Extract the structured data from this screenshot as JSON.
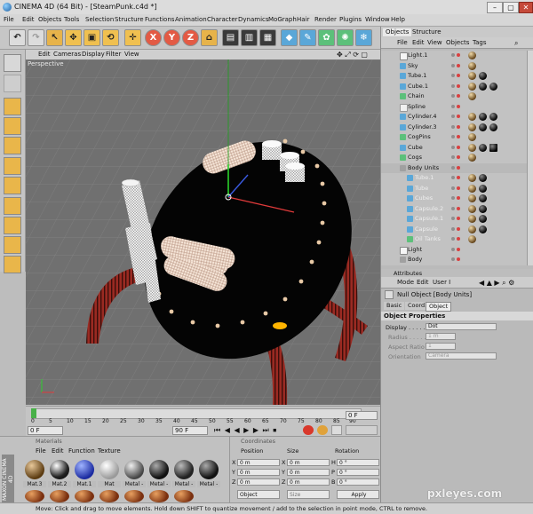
{
  "window": {
    "title": "CINEMA 4D (64 Bit) - [SteamPunk.c4d *]"
  },
  "menu": [
    "File",
    "Edit",
    "Objects",
    "Tools",
    "Selection",
    "Structure",
    "Functions",
    "Animation",
    "Character",
    "Dynamics",
    "MoGraph",
    "Hair",
    "Render",
    "Plugins",
    "Window",
    "Help"
  ],
  "toolbar": {
    "x": "X",
    "y": "Y",
    "z": "Z"
  },
  "viewport": {
    "menu": [
      "Edit",
      "Cameras",
      "Display",
      "Filter",
      "View"
    ],
    "label": "Perspective"
  },
  "timeline": {
    "current_frame": "0 F",
    "start": "0 F",
    "end": "90 F",
    "ticks": [
      "0",
      "5",
      "10",
      "15",
      "20",
      "25",
      "30",
      "35",
      "40",
      "45",
      "50",
      "55",
      "60",
      "65",
      "70",
      "75",
      "80",
      "85",
      "90"
    ]
  },
  "materials": {
    "header": "Materials",
    "menu": [
      "File",
      "Edit",
      "Function",
      "Texture"
    ],
    "row1": [
      "Mat.3",
      "Mat.2",
      "Mat.1",
      "Mat",
      "Metal -",
      "Metal -",
      "Metal -",
      "Metal -"
    ],
    "colors": {
      "accent": "#b33a2e"
    }
  },
  "coords": {
    "header": "Coordinates",
    "cols": [
      "Position",
      "Size",
      "Rotation"
    ],
    "rows": [
      {
        "axis": "X",
        "pos": "0 m",
        "sz": "X",
        "szv": "0 m",
        "rot": "H",
        "rotv": "0 °"
      },
      {
        "axis": "Y",
        "pos": "0 m",
        "sz": "Y",
        "szv": "0 m",
        "rot": "P",
        "rotv": "0 °"
      },
      {
        "axis": "Z",
        "pos": "0 m",
        "sz": "Z",
        "szv": "0 m",
        "rot": "B",
        "rotv": "0 °"
      }
    ],
    "mode": "Object",
    "size_mode": "Size",
    "apply": "Apply"
  },
  "objects": {
    "tabs": [
      "Objects",
      "Structure"
    ],
    "menu": [
      "File",
      "Edit",
      "View",
      "Objects",
      "Tags"
    ],
    "items": [
      {
        "name": "Light.1",
        "indent": 0
      },
      {
        "name": "Sky",
        "indent": 0
      },
      {
        "name": "Tube.1",
        "indent": 0
      },
      {
        "name": "Cube.1",
        "indent": 0
      },
      {
        "name": "Chain",
        "indent": 0
      },
      {
        "name": "Spline",
        "indent": 0
      },
      {
        "name": "Cylinder.4",
        "indent": 0
      },
      {
        "name": "Cylinder.3",
        "indent": 0
      },
      {
        "name": "CogPins",
        "indent": 0
      },
      {
        "name": "Cube",
        "indent": 0
      },
      {
        "name": "Cogs",
        "indent": 0
      },
      {
        "name": "Body Units",
        "indent": 0
      },
      {
        "name": "Tube.1",
        "indent": 1
      },
      {
        "name": "Tube",
        "indent": 1
      },
      {
        "name": "Cubes",
        "indent": 1
      },
      {
        "name": "Capsule.2",
        "indent": 1
      },
      {
        "name": "Capsule.1",
        "indent": 1
      },
      {
        "name": "Capsule",
        "indent": 1
      },
      {
        "name": "Oil Tanks",
        "indent": 1
      },
      {
        "name": "Light",
        "indent": 0
      },
      {
        "name": "Body",
        "indent": 0
      }
    ]
  },
  "attributes": {
    "header": "Attributes",
    "menu": [
      "Mode",
      "Edit",
      "User I"
    ],
    "object_title": "Null Object [Body Units]",
    "tabs": [
      "Basic",
      "Coord.",
      "Object"
    ],
    "section": "Object Properties",
    "props": [
      {
        "label": "Display . . . . .",
        "value": "Dot"
      },
      {
        "label": "Radius . . . . .",
        "value": "1 m"
      },
      {
        "label": "Aspect Ratio . .",
        "value": "1"
      },
      {
        "label": "Orientation",
        "value": "Camera"
      }
    ]
  },
  "status": "Move: Click and drag to move elements. Hold down SHIFT to quantize movement / add to the selection in point mode, CTRL to remove.",
  "watermark": "pxleyes.com",
  "brand": "MAXON CINEMA 4D"
}
